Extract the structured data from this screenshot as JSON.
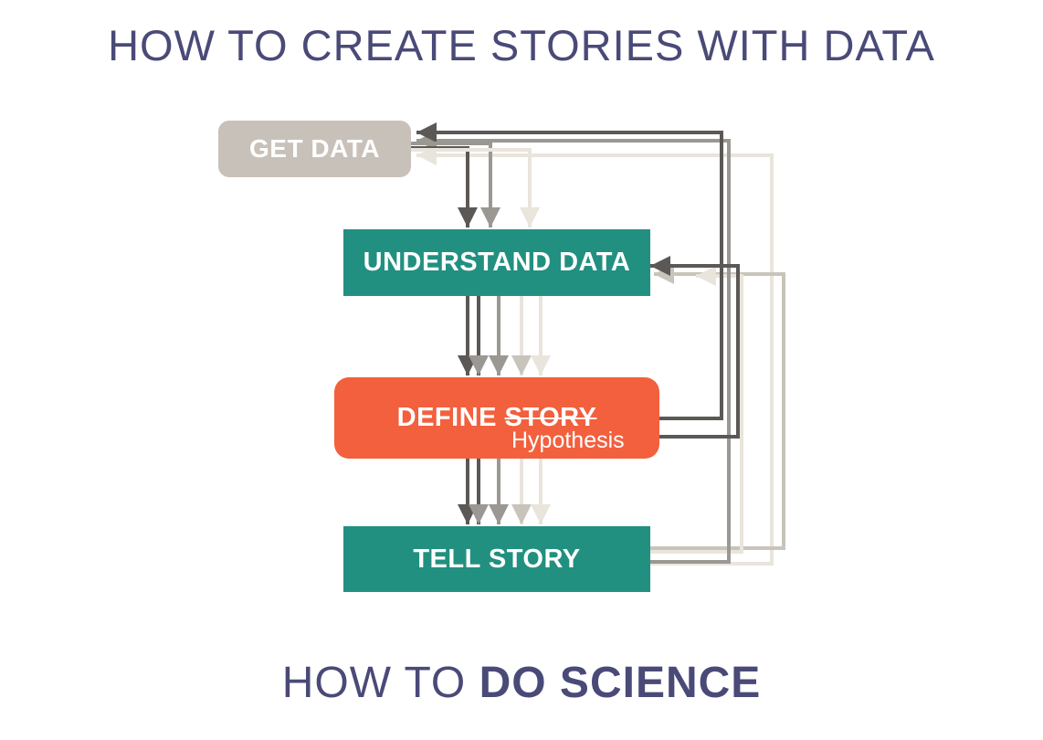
{
  "title": "HOW TO CREATE STORIES WITH DATA",
  "nodes": {
    "get_data": "GET DATA",
    "understand_data": "UNDERSTAND DATA",
    "define_prefix": "DEFINE",
    "define_struck": "STORY",
    "define_replacement": "Hypothesis",
    "tell_story": "TELL STORY"
  },
  "footer": {
    "prefix": "HOW TO",
    "emphasis": "DO SCIENCE"
  },
  "colors": {
    "title": "#4a4a78",
    "get_data_box": "#c8c1ba",
    "teal_box": "#219080",
    "define_box": "#f2603e",
    "arrow_dark": "#5b5856",
    "arrow_mid": "#9b9893",
    "arrow_light": "#c9c4bb",
    "arrow_pale": "#e9e5dc"
  }
}
